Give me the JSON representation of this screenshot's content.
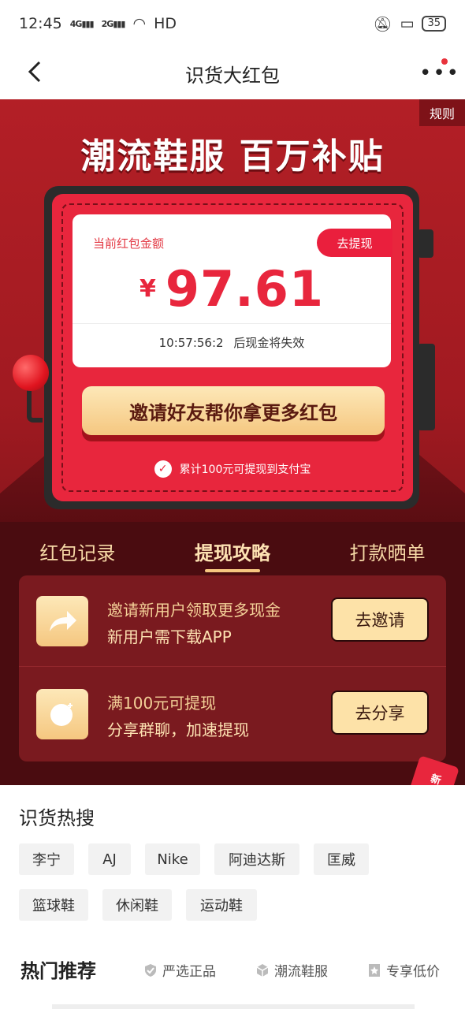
{
  "status_bar": {
    "time": "12:45",
    "net1": "4G",
    "net2": "2G",
    "wifi_label": "HD",
    "battery": "35"
  },
  "nav": {
    "title": "识货大红包"
  },
  "hero": {
    "rules": "规则",
    "title": "潮流鞋服 百万补贴",
    "panel_label": "当前红包金额",
    "withdraw": "去提现",
    "currency": "¥",
    "amount": "97.61",
    "countdown": "10:57:56:2",
    "expire_text": "后现金将失效",
    "invite_button": "邀请好友帮你拿更多红包",
    "alipay_note": "累计100元可提现到支付宝"
  },
  "tabs": [
    {
      "label": "红包记录",
      "active": false
    },
    {
      "label": "提现攻略",
      "active": true
    },
    {
      "label": "打款晒单",
      "active": false
    }
  ],
  "tasks": [
    {
      "line1": "邀请新用户领取更多现金",
      "line2": "新用户需下载APP",
      "button": "去邀请",
      "icon": "share-arrow-icon"
    },
    {
      "line1": "满100元可提现",
      "line2": "分享群聊，加速提现",
      "button": "去分享",
      "icon": "chat-bubble-icon"
    }
  ],
  "gift": {
    "label": "新人好礼"
  },
  "hot_search": {
    "title": "识货热搜",
    "chips": [
      "李宁",
      "AJ",
      "Nike",
      "阿迪达斯",
      "匡威",
      "篮球鞋",
      "休闲鞋",
      "运动鞋"
    ]
  },
  "recommend": {
    "title": "热门推荐",
    "tags": [
      "严选正品",
      "潮流鞋服",
      "专享低价"
    ]
  },
  "colors": {
    "brand_red": "#e8263d",
    "dark_red": "#4a0c10",
    "gold": "#fde2a8"
  }
}
